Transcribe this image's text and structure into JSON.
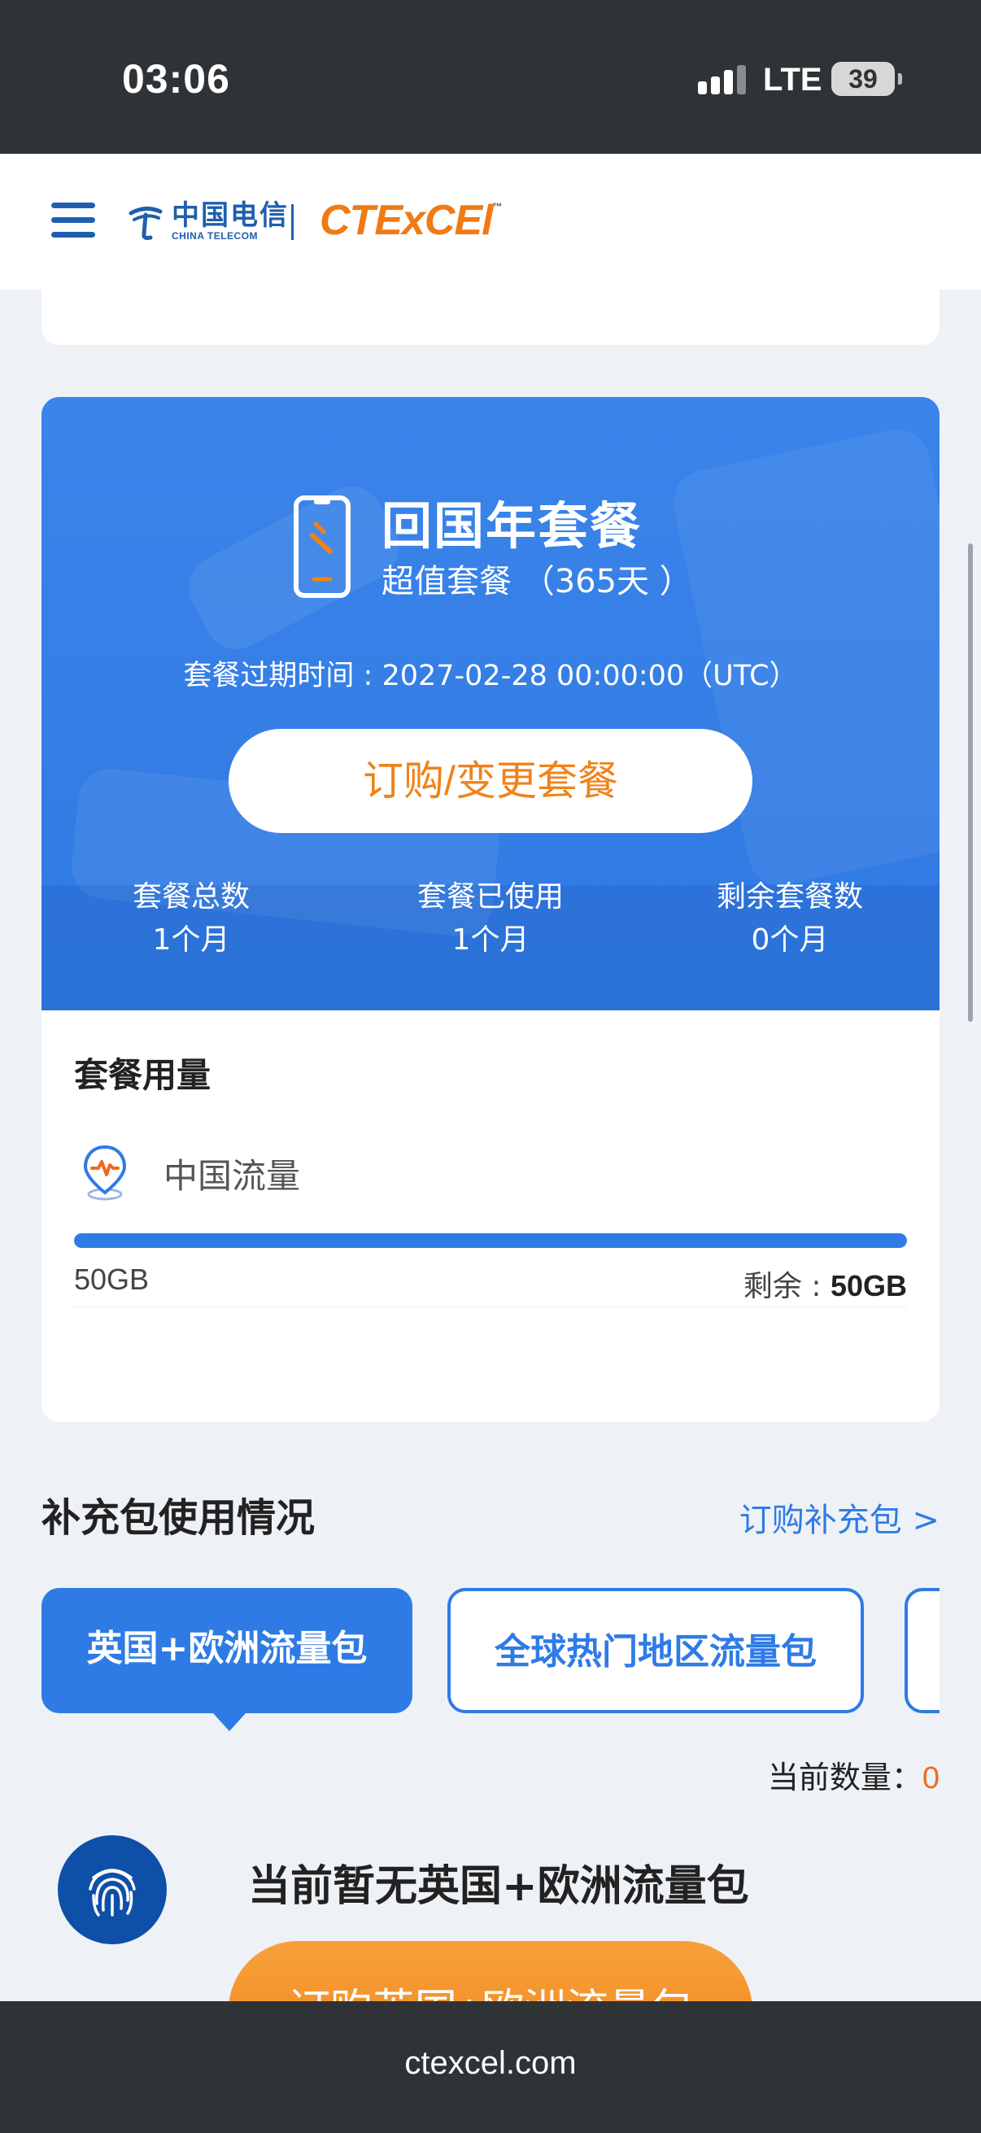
{
  "status_bar": {
    "time": "03:06",
    "network": "LTE",
    "battery": "39"
  },
  "header": {
    "logo_cn": "中国电信",
    "logo_en": "CHINA TELECOM",
    "brand": "CTExCEl",
    "brand_tm": "™"
  },
  "plan": {
    "title": "回国年套餐",
    "subtitle": "超值套餐 （365天 ）",
    "expiry": "套餐过期时间 : 2027-02-28 00:00:00（UTC）",
    "order_button": "订购/变更套餐",
    "stats": [
      {
        "label": "套餐总数",
        "value": "1个月"
      },
      {
        "label": "套餐已使用",
        "value": "1个月"
      },
      {
        "label": "剩余套餐数",
        "value": "0个月"
      }
    ]
  },
  "usage": {
    "title": "套餐用量",
    "item_label": "中国流量",
    "total": "50GB",
    "remaining_label": "剩余 : ",
    "remaining_value": "50GB",
    "remaining_fraction": 1.0
  },
  "addons": {
    "title": "补充包使用情况",
    "link": "订购补充包 >",
    "tabs": [
      {
        "label": "英国+欧洲流量包",
        "active": true
      },
      {
        "label": "全球热门地区流量包",
        "active": false
      }
    ],
    "count_label": "当前数量：",
    "count_value": "0",
    "empty_text": "当前暂无英国+欧洲流量包",
    "buy_button": "订购英国+欧洲流量包"
  },
  "url_bar": {
    "url": "ctexcel.com"
  },
  "colors": {
    "primary": "#2f7be5",
    "accent": "#f08219",
    "dark_bar": "#2f3336"
  },
  "icons": [
    "signal-icon",
    "battery-icon",
    "menu-icon",
    "phone-icon",
    "location-pulse-icon",
    "fingerprint-icon"
  ]
}
